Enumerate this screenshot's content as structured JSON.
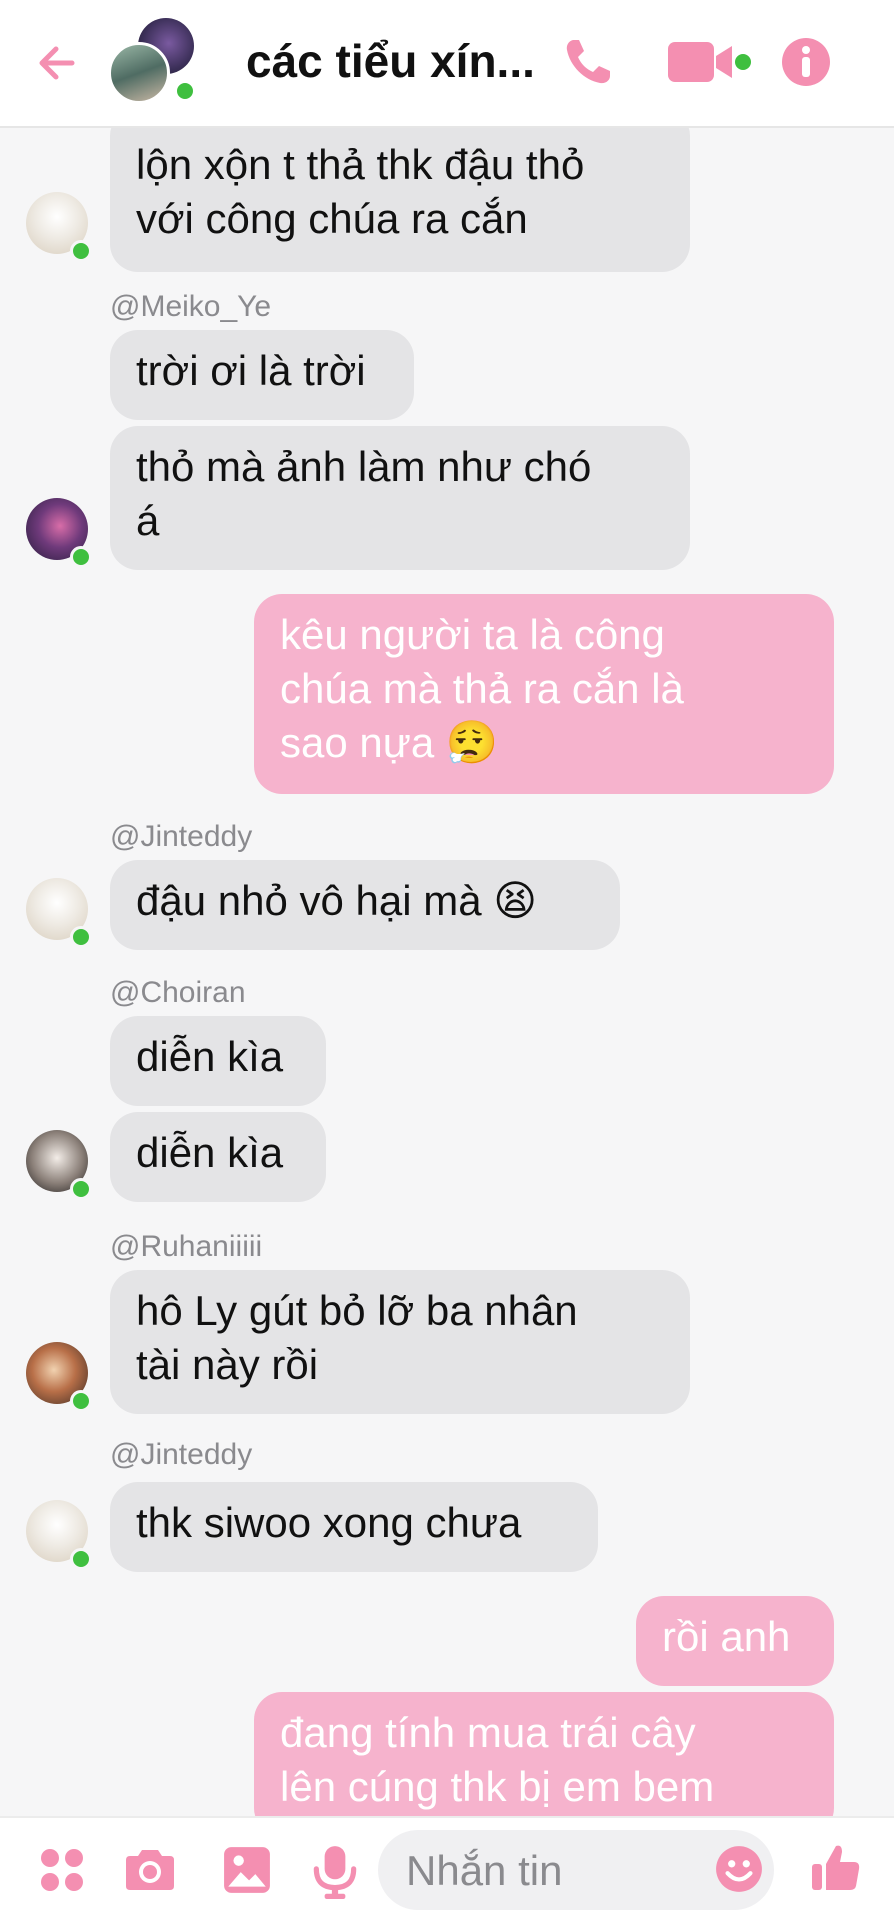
{
  "header": {
    "title": "các tiểu xín...",
    "icons": [
      "back-arrow-icon",
      "phone-icon",
      "video-icon",
      "info-icon"
    ],
    "accent_color": "#f48fb1"
  },
  "messages": [
    {
      "side": "in",
      "lines": [
        "lộn xộn t thả thk đậu thỏ",
        "với công chúa ra cắn"
      ],
      "avatar": "bear"
    },
    {
      "side": "in",
      "sender": "@Meiko_Ye",
      "lines": [
        "trời ơi là trời"
      ]
    },
    {
      "side": "in",
      "lines": [
        "thỏ mà ảnh làm như chó",
        "á"
      ],
      "avatar": "purple"
    },
    {
      "side": "out",
      "lines": [
        "kêu người ta là công",
        "chúa mà thả ra cắn là",
        "sao nựa 😮‍💨"
      ]
    },
    {
      "side": "in",
      "sender": "@Jinteddy",
      "lines": [
        "đậu nhỏ vô hại mà 😫"
      ],
      "avatar": "bear"
    },
    {
      "side": "in",
      "sender": "@Choiran",
      "lines": [
        "diễn kìa"
      ]
    },
    {
      "side": "in",
      "lines": [
        "diễn kìa"
      ],
      "avatar": "boy"
    },
    {
      "side": "in",
      "sender": "@Ruhaniiiii",
      "lines": [
        "hô Ly gút bỏ lỡ ba nhân",
        "tài này rồi"
      ],
      "avatar": "red"
    },
    {
      "side": "in",
      "sender": "@Jinteddy",
      "lines": [
        "thk siwoo xong chưa"
      ],
      "avatar": "bear"
    },
    {
      "side": "out",
      "lines": [
        "rồi anh"
      ]
    },
    {
      "side": "out",
      "lines": [
        "đang tính mua trái cây",
        "lên cúng thk bị em bem"
      ]
    }
  ],
  "composer": {
    "placeholder": "Nhắn tin",
    "icons": [
      "apps-icon",
      "camera-icon",
      "gallery-icon",
      "microphone-icon",
      "emoji-icon",
      "thumbs-up-icon"
    ]
  }
}
